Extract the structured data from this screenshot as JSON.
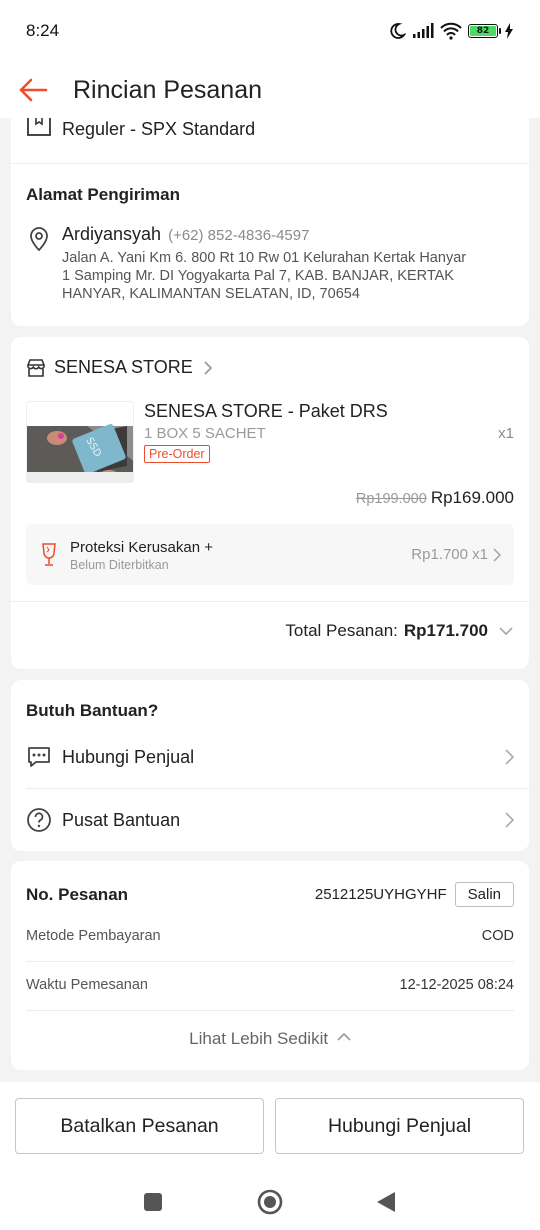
{
  "status_bar": {
    "time": "8:24",
    "battery": "82"
  },
  "header": {
    "title": "Rincian Pesanan"
  },
  "shipping": {
    "method": "Reguler - SPX Standard"
  },
  "address": {
    "section_title": "Alamat Pengiriman",
    "name": "Ardiyansyah",
    "phone": "(+62) 852-4836-4597",
    "lines": [
      "Jalan A. Yani Km 6. 800 Rt 10 Rw 01 Kelurahan Kertak Hanyar",
      "1 Samping Mr. DI Yogyakarta Pal 7, KAB. BANJAR, KERTAK",
      "HANYAR, KALIMANTAN SELATAN, ID, 70654"
    ]
  },
  "store": {
    "name": "SENESA STORE",
    "product": {
      "name": "SENESA STORE - Paket DRS",
      "variant": "1 BOX 5 SACHET",
      "quantity": "x1",
      "badge": "Pre-Order",
      "image_label": "SSD",
      "price_original": "Rp199.000",
      "price_final": "Rp169.000"
    },
    "protection": {
      "title": "Proteksi Kerusakan +",
      "status": "Belum Diterbitkan",
      "price": "Rp1.700 x1"
    },
    "total_label": "Total Pesanan:",
    "total_value": "Rp171.700"
  },
  "help": {
    "title": "Butuh Bantuan?",
    "contact_seller": "Hubungi Penjual",
    "help_center": "Pusat Bantuan"
  },
  "order_info": {
    "order_no_label": "No. Pesanan",
    "order_no": "2512125UYHGYHF",
    "copy_label": "Salin",
    "payment_label": "Metode Pembayaran",
    "payment_value": "COD",
    "time_label": "Waktu Pemesanan",
    "time_value": "12-12-2025 08:24",
    "see_less": "Lihat Lebih Sedikit"
  },
  "actions": {
    "cancel": "Batalkan Pesanan",
    "contact": "Hubungi Penjual"
  },
  "colors": {
    "accent": "#ee4d2d",
    "battery_fill": "#4cd964"
  },
  "icons": [
    "moon-icon",
    "signal-icon",
    "wifi-icon",
    "battery-icon",
    "charging-icon",
    "back-arrow-icon",
    "package-icon",
    "location-pin-icon",
    "store-icon",
    "chevron-right-icon",
    "glass-icon",
    "chevron-down-icon",
    "chat-icon",
    "help-icon",
    "chevron-up-icon",
    "recent-apps-icon",
    "home-icon",
    "back-triangle-icon"
  ]
}
